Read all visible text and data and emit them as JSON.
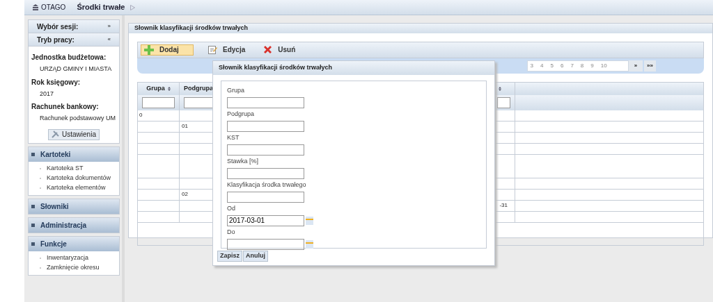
{
  "topbar": {
    "logo": "OTAGO",
    "breadcrumb": "Środki trwałe"
  },
  "sidebar": {
    "headers": [
      {
        "label": "Wybór sesji:",
        "toggle": "»"
      },
      {
        "label": "Tryb pracy:",
        "toggle": "«"
      }
    ],
    "info": [
      {
        "label": "Jednostka budżetowa:",
        "value": "URZĄD GMINY I MIASTA"
      },
      {
        "label": "Rok księgowy:",
        "value": "2017"
      },
      {
        "label": "Rachunek bankowy:",
        "value": "Rachunek podstawowy UM"
      }
    ],
    "settings_button": "Ustawienia",
    "sections": [
      {
        "title": "Kartoteki",
        "items": [
          "Kartoteka ST",
          "Kartoteka dokumentów",
          "Kartoteka elementów"
        ]
      },
      {
        "title": "Słowniki"
      },
      {
        "title": "Administracja"
      },
      {
        "title": "Funkcje",
        "items": [
          "Inwentaryzacja",
          "Zamknięcie okresu"
        ]
      }
    ]
  },
  "panel": {
    "title": "Słownik klasyfikacji środków trwałych",
    "toolbar": [
      {
        "kind": "add",
        "label": "Dodaj",
        "selected": true
      },
      {
        "kind": "edit",
        "label": "Edycja",
        "selected": false
      },
      {
        "kind": "delete",
        "label": "Usuń",
        "selected": false
      }
    ],
    "pager": {
      "pages": [
        "3",
        "4",
        "5",
        "6",
        "7",
        "8",
        "9",
        "10"
      ],
      "next": "»",
      "last": "»»"
    },
    "table": {
      "columns": [
        "Grupa",
        "Podgrupa"
      ],
      "rows": [
        {
          "grupa": "0",
          "tall": false
        },
        {
          "podgrupa": "01",
          "tall": false
        },
        {
          "tall": false
        },
        {
          "tall": false
        },
        {
          "tall": true
        },
        {
          "tall": false
        },
        {
          "podgrupa": "02",
          "tall": false
        },
        {
          "column_3": "-31",
          "tall": false
        },
        {
          "tall": false
        }
      ]
    }
  },
  "dialog": {
    "title": "Słownik klasyfikacji środków trwałych",
    "fields": [
      {
        "kind": "text",
        "label": "Grupa"
      },
      {
        "kind": "text",
        "label": "Podgrupa"
      },
      {
        "kind": "text",
        "label": "KST"
      },
      {
        "kind": "text",
        "label": "Stawka [%]"
      },
      {
        "kind": "text",
        "label": "Klasyfikacja środka trwałego"
      },
      {
        "kind": "date",
        "label": "Od",
        "value": "2017-03-01"
      },
      {
        "kind": "date",
        "label": "Do"
      }
    ],
    "buttons": [
      "Zapisz",
      "Anuluj"
    ]
  }
}
